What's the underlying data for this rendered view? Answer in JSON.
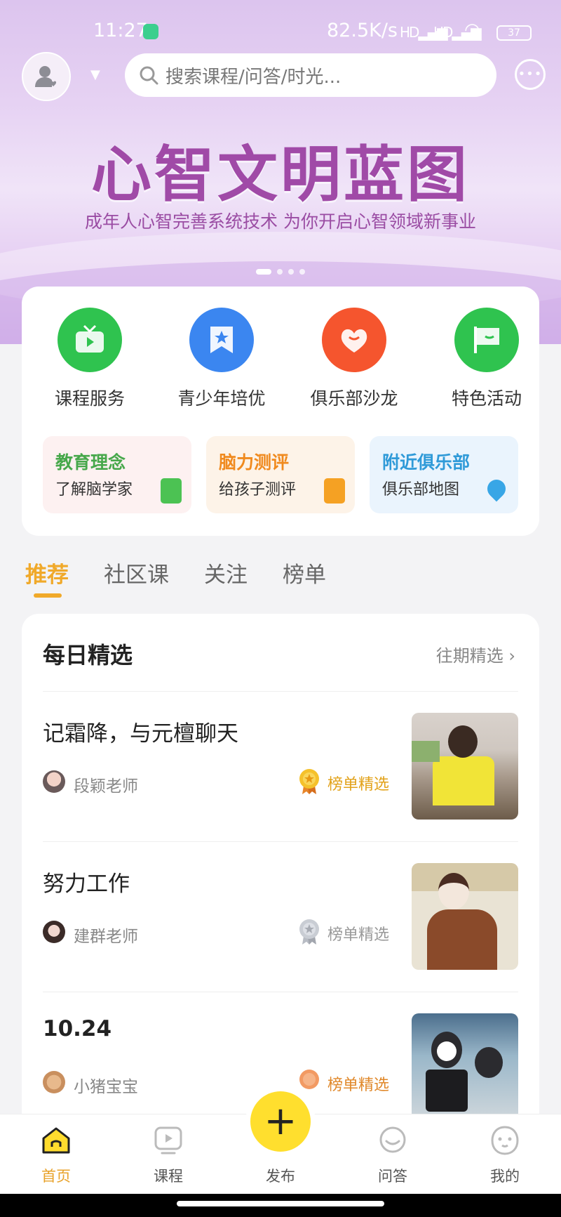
{
  "status_bar": {
    "time": "11:27",
    "speed": "82.5K/s",
    "signal1": "HD",
    "signal2": "HD",
    "battery": "37"
  },
  "header": {
    "search_placeholder": "搜索课程/问答/时光..."
  },
  "banner": {
    "title": "心智文明蓝图",
    "subtitle": "成年人心智完善系统技术 为你开启心智领域新事业",
    "slide_count": 4,
    "active_slide": 1
  },
  "quick_entries": [
    {
      "label": "课程服务",
      "color": "#2fc34f",
      "icon": "tv-icon"
    },
    {
      "label": "青少年培优",
      "color": "#3b86f0",
      "icon": "bookmark-star-icon"
    },
    {
      "label": "俱乐部沙龙",
      "color": "#f5552e",
      "icon": "heart-face-icon"
    },
    {
      "label": "特色活动",
      "color": "#2fc34f",
      "icon": "flag-icon"
    }
  ],
  "tiles": [
    {
      "title": "教育理念",
      "subtitle": "了解脑学家",
      "title_color": "#47a84b",
      "bg": "#fdf1f1",
      "icon": "book-icon",
      "icon_color": "#4cc253"
    },
    {
      "title": "脑力测评",
      "subtitle": "给孩子测评",
      "title_color": "#f08a1e",
      "bg": "#fdf3e8",
      "icon": "document-icon",
      "icon_color": "#f5a123"
    },
    {
      "title": "附近俱乐部",
      "subtitle": "俱乐部地图",
      "title_color": "#2f9ad8",
      "bg": "#eaf4fd",
      "icon": "location-pin-icon",
      "icon_color": "#38a6e6"
    }
  ],
  "tabs": [
    {
      "label": "推荐",
      "active": true
    },
    {
      "label": "社区课",
      "active": false
    },
    {
      "label": "关注",
      "active": false
    },
    {
      "label": "榜单",
      "active": false
    }
  ],
  "daily": {
    "title": "每日精选",
    "more_label": "往期精选",
    "posts": [
      {
        "title": "记霜降，与元檀聊天",
        "author": "段颖老师",
        "badge": "榜单精选",
        "badge_color": "#e2a21a",
        "medal": "gold"
      },
      {
        "title": "努力工作",
        "author": "建群老师",
        "badge": "榜单精选",
        "badge_color": "#999999",
        "medal": "silver"
      },
      {
        "title": "10.24",
        "author": "小猪宝宝",
        "badge": "榜单精选",
        "badge_color": "#e0882a",
        "medal": "bronze"
      }
    ]
  },
  "bottom_nav": [
    {
      "label": "首页",
      "icon": "home-icon",
      "active": true
    },
    {
      "label": "课程",
      "icon": "play-screen-icon",
      "active": false
    },
    {
      "label": "发布",
      "icon": "plus-icon",
      "active": false
    },
    {
      "label": "问答",
      "icon": "smile-bubble-icon",
      "active": false
    },
    {
      "label": "我的",
      "icon": "face-icon",
      "active": false
    }
  ]
}
